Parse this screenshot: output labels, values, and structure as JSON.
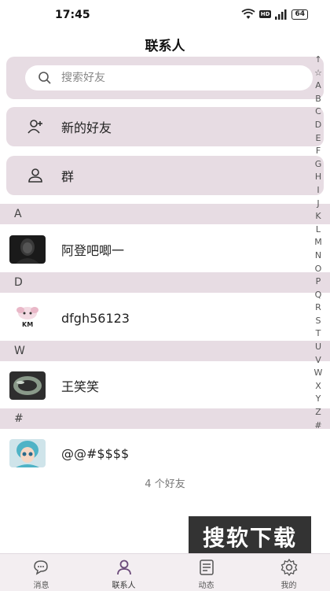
{
  "status_bar": {
    "time": "17:45",
    "network_badge": "HD",
    "battery_level": "64"
  },
  "header": {
    "title": "联系人"
  },
  "search": {
    "placeholder": "搜索好友"
  },
  "menu": {
    "new_friends_label": "新的好友",
    "groups_label": "群"
  },
  "sections": [
    {
      "letter": "A",
      "contact": "阿登吧唧一"
    },
    {
      "letter": "D",
      "contact": "dfgh56123"
    },
    {
      "letter": "W",
      "contact": "王笑笑"
    },
    {
      "letter": "#",
      "contact": "@@#$$$$"
    }
  ],
  "avatar_badge_text": "KM",
  "friend_count_text": "4 个好友",
  "index_letters": [
    "↑",
    "☆",
    "A",
    "B",
    "C",
    "D",
    "E",
    "F",
    "G",
    "H",
    "I",
    "J",
    "K",
    "L",
    "M",
    "N",
    "O",
    "P",
    "Q",
    "R",
    "S",
    "T",
    "U",
    "V",
    "W",
    "X",
    "Y",
    "Z",
    "#"
  ],
  "watermark": "搜软下载",
  "tabs": [
    {
      "label": "消息",
      "icon": "chat-icon",
      "active": false
    },
    {
      "label": "联系人",
      "icon": "person-icon",
      "active": true
    },
    {
      "label": "动态",
      "icon": "feed-icon",
      "active": false
    },
    {
      "label": "我的",
      "icon": "gear-icon",
      "active": false
    }
  ],
  "colors": {
    "accent": "#e7dce3",
    "tab_active": "#6b4a7a"
  }
}
